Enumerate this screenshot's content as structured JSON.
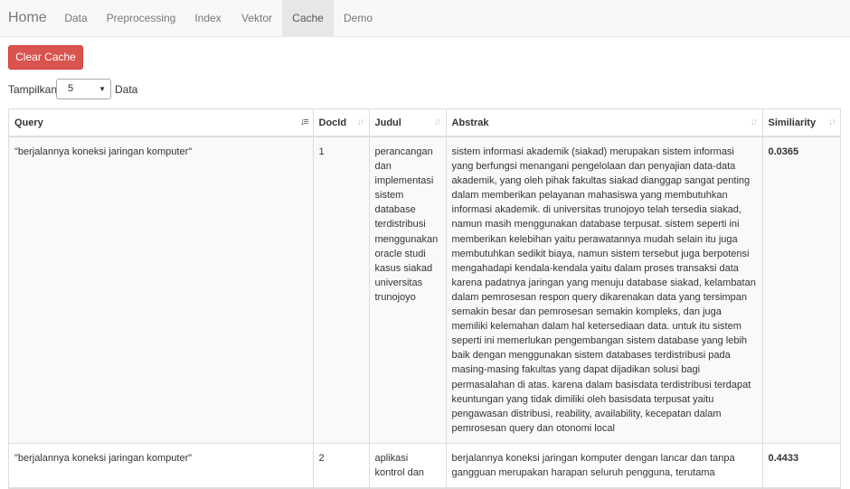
{
  "navbar": {
    "brand": "Home",
    "items": [
      {
        "label": "Data"
      },
      {
        "label": "Preprocessing"
      },
      {
        "label": "Index"
      },
      {
        "label": "Vektor"
      },
      {
        "label": "Cache"
      },
      {
        "label": "Demo"
      }
    ],
    "active": "Cache"
  },
  "actions": {
    "clear_cache": "Clear Cache"
  },
  "length_menu": {
    "prefix": "Tampilkan",
    "value": "5",
    "suffix": "Data"
  },
  "table": {
    "columns": [
      {
        "label": "Query",
        "sorted": true
      },
      {
        "label": "DocId"
      },
      {
        "label": "Judul"
      },
      {
        "label": "Abstrak"
      },
      {
        "label": "Similiarity"
      }
    ],
    "rows": [
      {
        "query": "\"berjalannya koneksi jaringan komputer\"",
        "docid": "1",
        "judul": "perancangan dan implementasi sistem database terdistribusi menggunakan oracle studi kasus siakad universitas trunojoyo",
        "abstrak": "sistem informasi akademik (siakad) merupakan sistem informasi yang berfungsi menangani pengelolaan dan penyajian data-data akademik, yang oleh pihak fakultas siakad dianggap sangat penting dalam memberikan pelayanan mahasiswa yang membutuhkan informasi akademik. di universitas trunojoyo telah tersedia siakad, namun masih menggunakan database terpusat. sistem seperti ini memberikan kelebihan yaitu perawatannya mudah selain itu juga membutuhkan sedikit biaya, namun sistem tersebut juga berpotensi mengahadapi kendala-kendala yaitu dalam proses transaksi data karena padatnya jaringan yang menuju database siakad, kelambatan dalam pemrosesan respon query dikarenakan data yang tersimpan semakin besar dan pemrosesan semakin kompleks, dan juga memiliki kelemahan dalam hal ketersediaan data. untuk itu sistem seperti ini memerlukan pengembangan sistem database yang lebih baik dengan menggunakan sistem databases terdistribusi pada masing-masing fakultas yang dapat dijadikan solusi bagi permasalahan di atas. karena dalam basisdata terdistribusi terdapat keuntungan yang tidak dimiliki oleh basisdata terpusat yaitu pengawasan distribusi, reability, availability, kecepatan dalam pemrosesan query dan otonomi local",
        "similarity": "0.0365"
      },
      {
        "query": "\"berjalannya koneksi jaringan komputer\"",
        "docid": "2",
        "judul": "aplikasi kontrol dan",
        "abstrak": "berjalannya koneksi jaringan komputer dengan lancar dan tanpa gangguan merupakan harapan seluruh pengguna, terutama",
        "similarity": "0.4433"
      }
    ]
  }
}
